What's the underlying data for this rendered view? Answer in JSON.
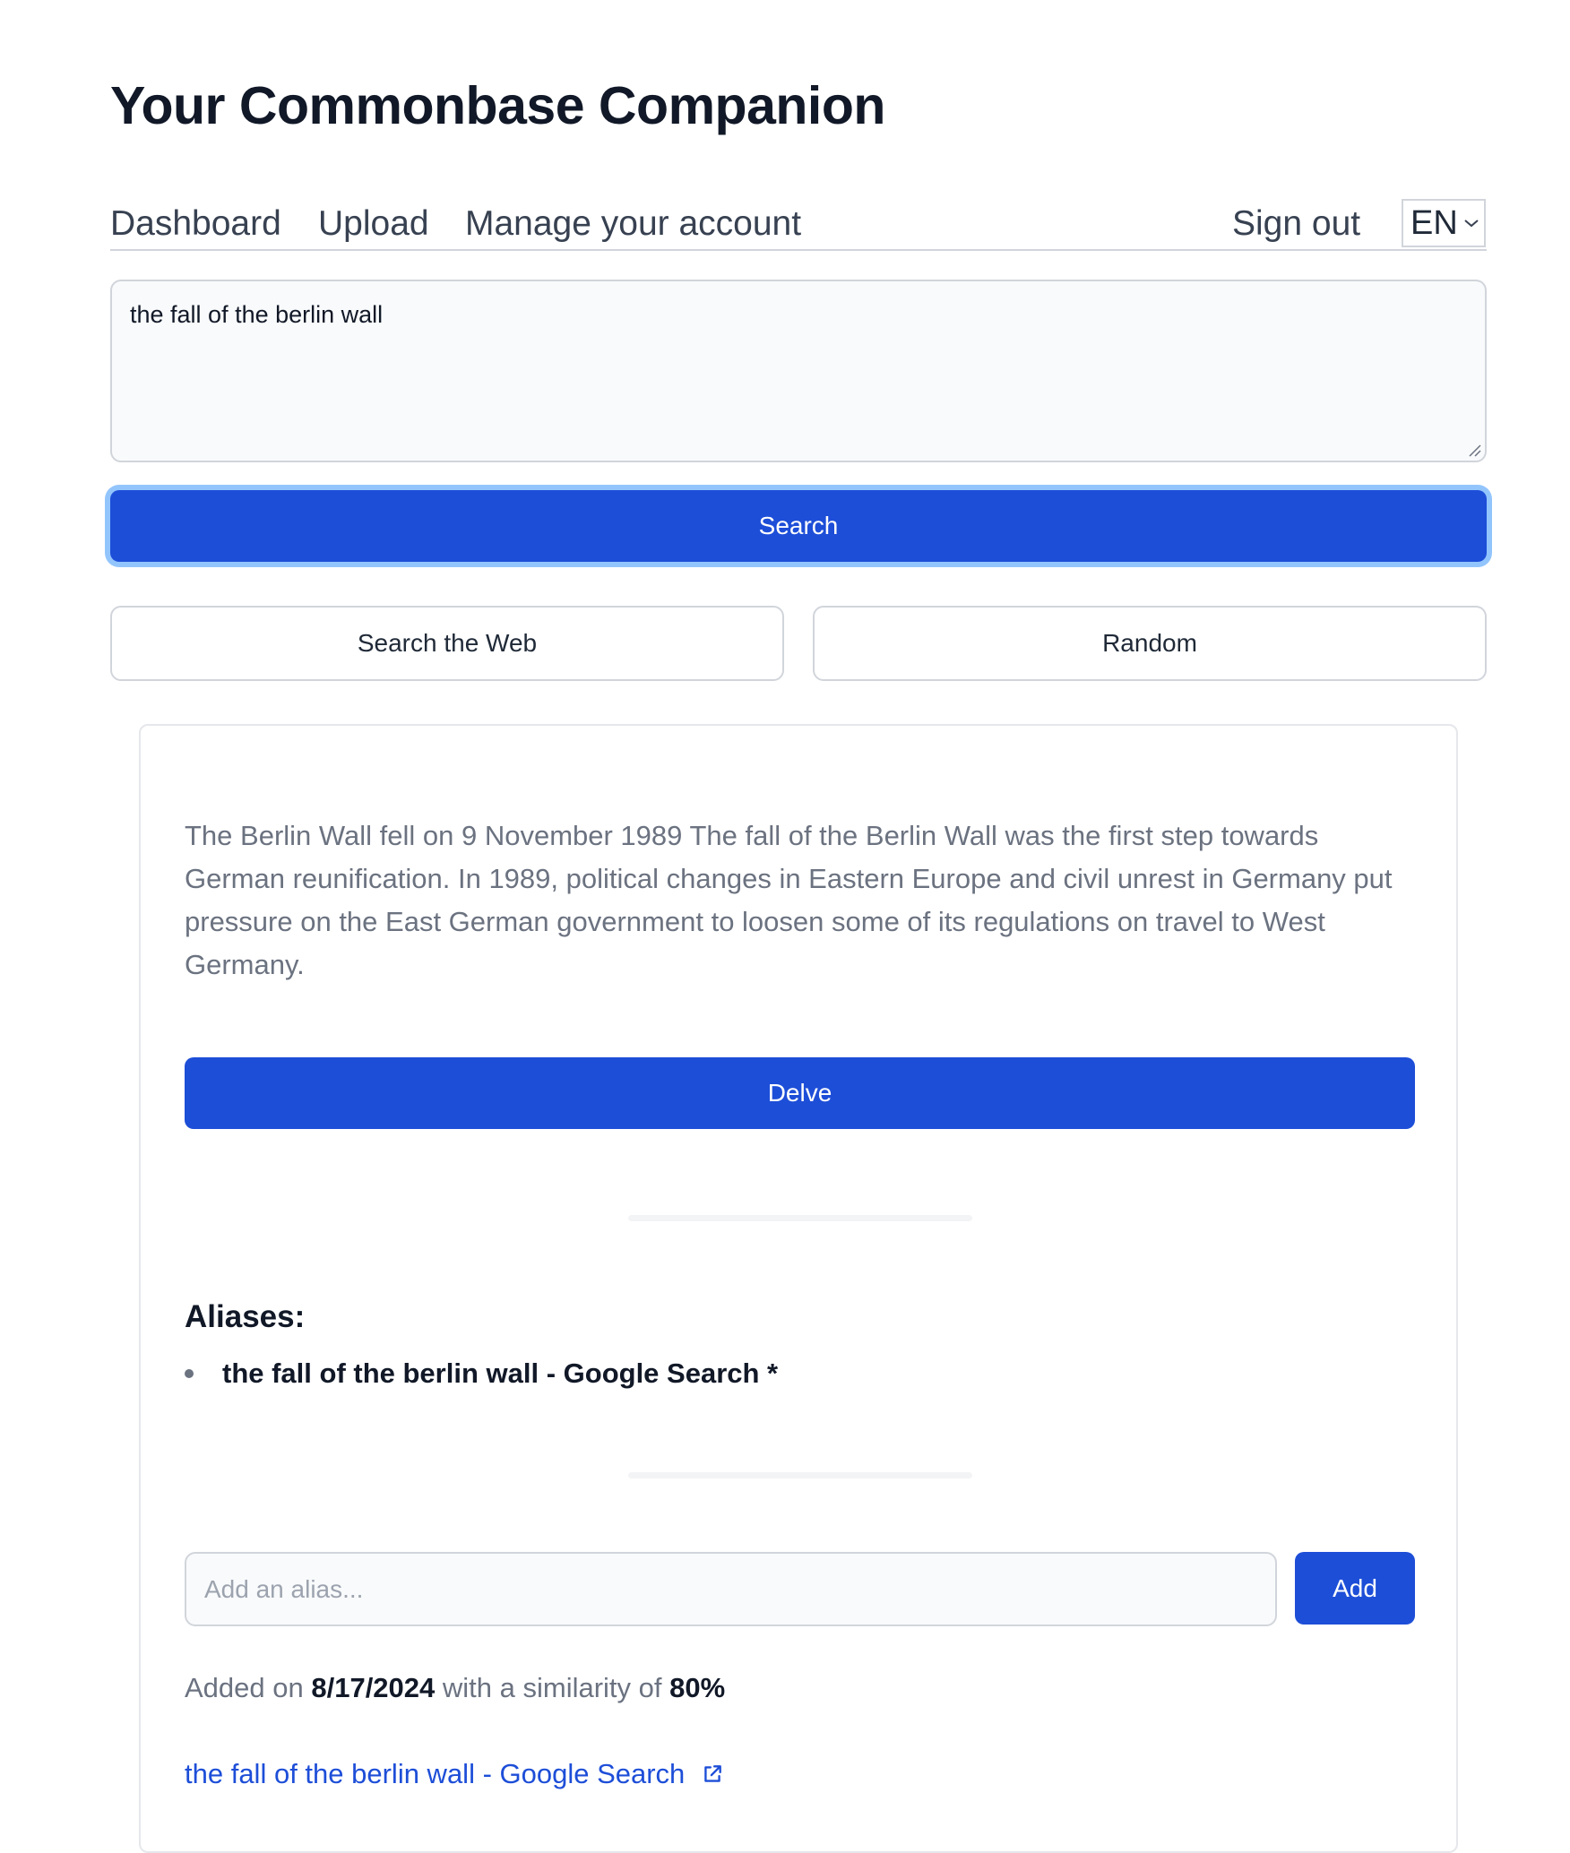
{
  "app": {
    "title": "Your Commonbase Companion"
  },
  "nav": {
    "dashboard": "Dashboard",
    "upload": "Upload",
    "account": "Manage your account",
    "signout": "Sign out",
    "language": "EN"
  },
  "search": {
    "query": "the fall of the berlin wall",
    "search_label": "Search",
    "web_label": "Search the Web",
    "random_label": "Random"
  },
  "result": {
    "excerpt": "The Berlin Wall fell on 9 November 1989 The fall of the Berlin Wall was the first step towards German reunification. In 1989, political changes in Eastern Europe and civil unrest in Germany put pressure on the East German government to loosen some of its regulations on travel to West Germany.",
    "delve_label": "Delve",
    "aliases_heading": "Aliases:",
    "aliases": [
      {
        "label": "the fall of the berlin wall - Google Search *"
      }
    ],
    "alias_placeholder": "Add an alias...",
    "add_label": "Add",
    "added_prefix": "Added on",
    "added_date": "8/17/2024",
    "similarity_prefix": "with a similarity of",
    "similarity": "80%",
    "source_link_text": "the fall of the berlin wall - Google Search"
  },
  "colors": {
    "primary": "#1d4ed8",
    "focus_ring": "#93c5fd",
    "muted_text": "#6b7280",
    "border": "#d1d5db"
  },
  "icons": [
    "chevron-down-icon",
    "resize-grip-icon",
    "external-link-icon"
  ]
}
